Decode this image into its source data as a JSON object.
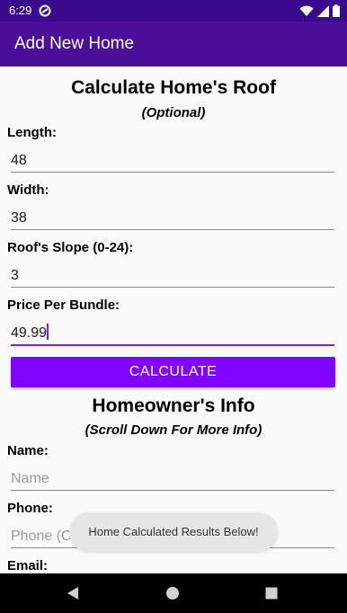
{
  "status_bar": {
    "time": "6:29",
    "icons": [
      "sync-icon",
      "wifi-icon",
      "signal-icon",
      "battery-icon"
    ]
  },
  "app_bar": {
    "title": "Add New Home"
  },
  "roof_section": {
    "title": "Calculate Home's Roof",
    "subtitle": "(Optional)",
    "fields": [
      {
        "label": "Length:",
        "value": "48"
      },
      {
        "label": "Width:",
        "value": "38"
      },
      {
        "label": "Roof's Slope (0-24):",
        "value": "3"
      },
      {
        "label": "Price Per Bundle:",
        "value": "49.99"
      }
    ],
    "button_label": "CALCULATE"
  },
  "homeowner_section": {
    "title": "Homeowner's Info",
    "subtitle": "(Scroll Down For More Info)",
    "fields": [
      {
        "label": "Name:",
        "placeholder": "Name"
      },
      {
        "label": "Phone:",
        "placeholder": "Phone (Cannot be separated from )"
      },
      {
        "label": "Email:",
        "placeholder": ""
      }
    ]
  },
  "toast": {
    "text": "Home Calculated Results Below!"
  },
  "nav_bar": {
    "buttons": [
      "back-icon",
      "home-icon",
      "recents-icon"
    ]
  },
  "colors": {
    "status_bar": "#3a0a8c",
    "app_bar": "#4a0f96",
    "accent": "#7f05ff",
    "focus_underline": "#7f1df0"
  }
}
